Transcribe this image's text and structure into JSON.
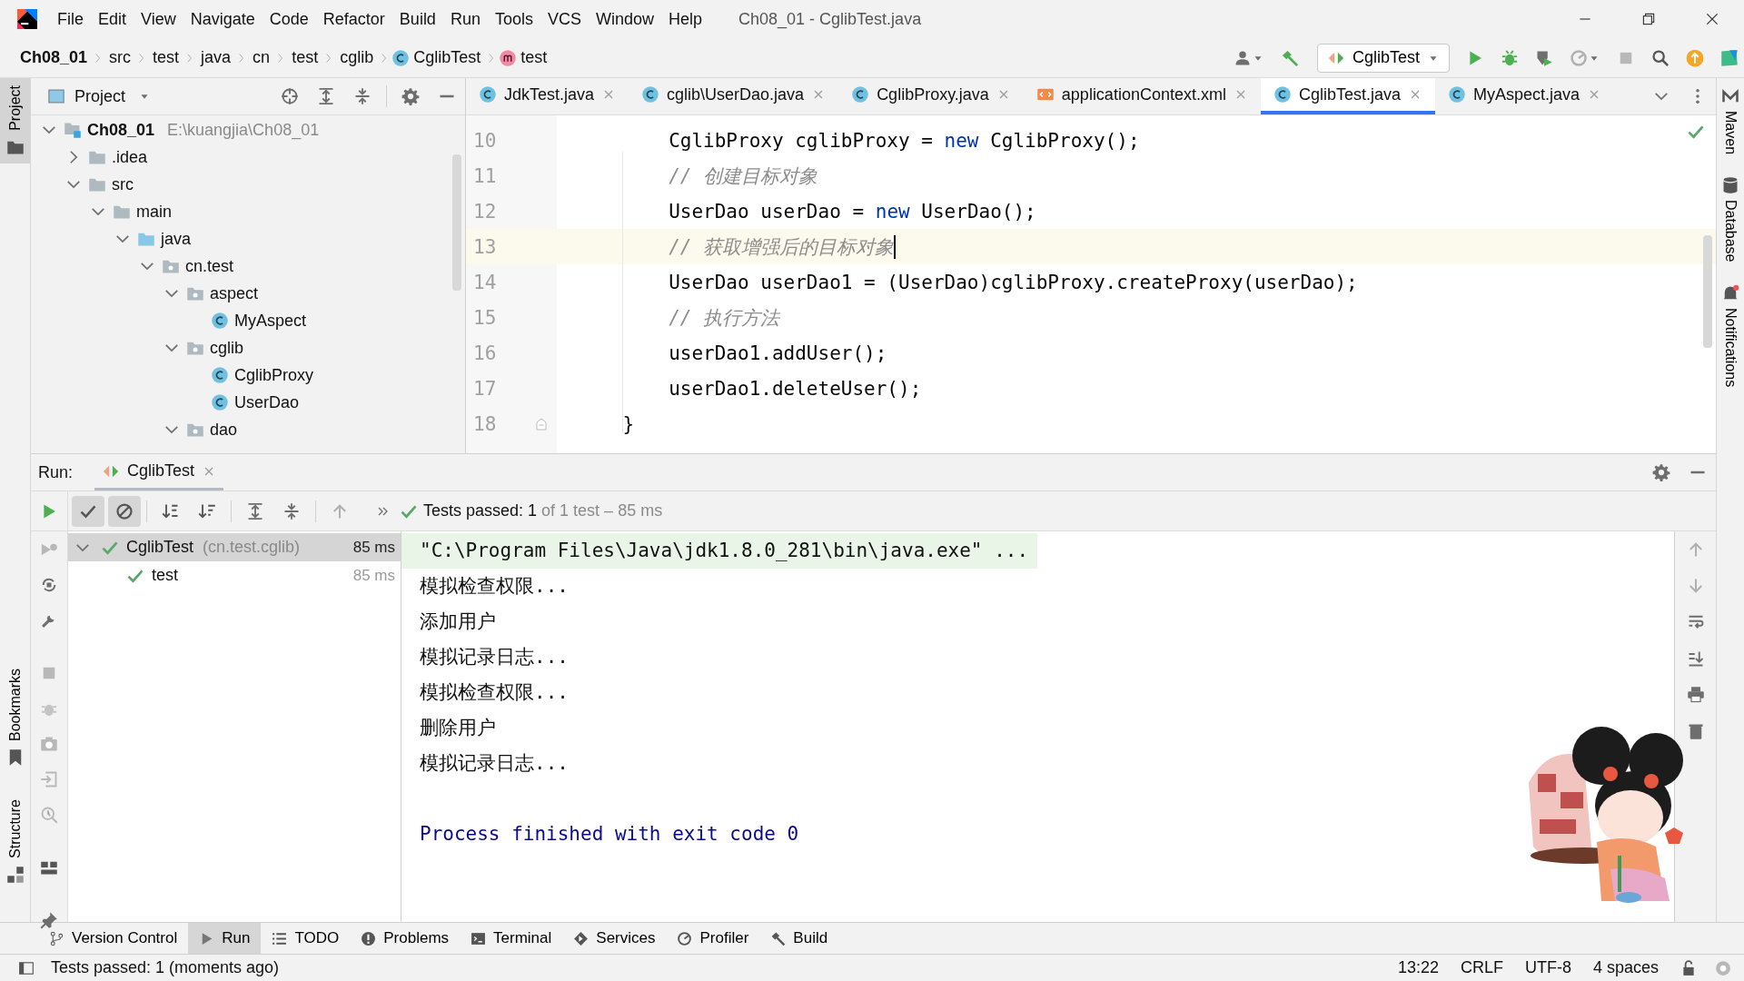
{
  "menu_bar": {
    "menus": [
      "File",
      "Edit",
      "View",
      "Navigate",
      "Code",
      "Refactor",
      "Build",
      "Run",
      "Tools",
      "VCS",
      "Window",
      "Help"
    ],
    "title": "Ch08_01 - CglibTest.java"
  },
  "breadcrumbs": [
    {
      "label": "Ch08_01",
      "kind": "project"
    },
    {
      "label": "src",
      "kind": "folder"
    },
    {
      "label": "test",
      "kind": "folder"
    },
    {
      "label": "java",
      "kind": "folder"
    },
    {
      "label": "cn",
      "kind": "folder"
    },
    {
      "label": "test",
      "kind": "folder"
    },
    {
      "label": "cglib",
      "kind": "folder"
    },
    {
      "label": "CglibTest",
      "kind": "class"
    },
    {
      "label": "test",
      "kind": "method"
    }
  ],
  "run_config": {
    "label": "CglibTest"
  },
  "left_stripe": [
    {
      "label": "Project",
      "kind": "project",
      "selected": true
    },
    {
      "label": "Bookmarks",
      "kind": "bookmarks",
      "selected": false
    },
    {
      "label": "Structure",
      "kind": "structure",
      "selected": false
    }
  ],
  "right_stripe": [
    {
      "label": "Maven",
      "kind": "maven"
    },
    {
      "label": "Database",
      "kind": "database"
    },
    {
      "label": "Notifications",
      "kind": "notifications"
    }
  ],
  "project_panel": {
    "title": "Project",
    "tree": [
      {
        "label": "Ch08_01",
        "kind": "module",
        "path": "E:\\kuangjia\\Ch08_01",
        "expanded": true,
        "children": [
          {
            "label": ".idea",
            "kind": "folder",
            "expanded": false
          },
          {
            "label": "src",
            "kind": "folder",
            "expanded": true,
            "children": [
              {
                "label": "main",
                "kind": "folder",
                "expanded": true,
                "children": [
                  {
                    "label": "java",
                    "kind": "source_root",
                    "expanded": true,
                    "children": [
                      {
                        "label": "cn.test",
                        "kind": "package",
                        "expanded": true,
                        "children": [
                          {
                            "label": "aspect",
                            "kind": "package",
                            "expanded": true,
                            "children": [
                              {
                                "label": "MyAspect",
                                "kind": "class"
                              }
                            ]
                          },
                          {
                            "label": "cglib",
                            "kind": "package",
                            "expanded": true,
                            "children": [
                              {
                                "label": "CglibProxy",
                                "kind": "class"
                              },
                              {
                                "label": "UserDao",
                                "kind": "class"
                              }
                            ]
                          },
                          {
                            "label": "dao",
                            "kind": "package",
                            "expanded": true
                          }
                        ]
                      }
                    ]
                  }
                ]
              }
            ]
          }
        ]
      }
    ]
  },
  "editor_tabs": [
    {
      "label": "JdkTest.java",
      "kind": "class",
      "selected": false
    },
    {
      "label": "cglib\\UserDao.java",
      "kind": "class",
      "selected": false
    },
    {
      "label": "CglibProxy.java",
      "kind": "class",
      "selected": false
    },
    {
      "label": "applicationContext.xml",
      "kind": "xml",
      "selected": false
    },
    {
      "label": "CglibTest.java",
      "kind": "class",
      "selected": true
    },
    {
      "label": "MyAspect.java",
      "kind": "class",
      "selected": false
    }
  ],
  "code": [
    {
      "number": "10",
      "current": false,
      "tokens": [
        {
          "kind": "plain",
          "text": "        CglibProxy cglibProxy = "
        },
        {
          "kind": "keyword",
          "text": "new"
        },
        {
          "kind": "plain",
          "text": " CglibProxy();"
        }
      ]
    },
    {
      "number": "11",
      "current": false,
      "tokens": [
        {
          "kind": "comment",
          "text": "        // 创建目标对象"
        }
      ]
    },
    {
      "number": "12",
      "current": false,
      "tokens": [
        {
          "kind": "plain",
          "text": "        UserDao userDao = "
        },
        {
          "kind": "keyword",
          "text": "new"
        },
        {
          "kind": "plain",
          "text": " UserDao();"
        }
      ]
    },
    {
      "number": "13",
      "current": true,
      "tokens": [
        {
          "kind": "comment",
          "text": "        // 获取增强后的目标对象"
        }
      ]
    },
    {
      "number": "14",
      "current": false,
      "tokens": [
        {
          "kind": "plain",
          "text": "        UserDao userDao1 = (UserDao)cglibProxy.createProxy(userDao);"
        }
      ]
    },
    {
      "number": "15",
      "current": false,
      "tokens": [
        {
          "kind": "comment",
          "text": "        // 执行方法"
        }
      ]
    },
    {
      "number": "16",
      "current": false,
      "tokens": [
        {
          "kind": "plain",
          "text": "        userDao1.addUser();"
        }
      ]
    },
    {
      "number": "17",
      "current": false,
      "tokens": [
        {
          "kind": "plain",
          "text": "        userDao1.deleteUser();"
        }
      ]
    },
    {
      "number": "18",
      "current": false,
      "tokens": [
        {
          "kind": "plain",
          "text": "    }"
        }
      ]
    }
  ],
  "run_panel": {
    "label": "Run:",
    "tab": "CglibTest",
    "toggles": [
      {
        "kind": "passed",
        "selected": true
      },
      {
        "kind": "ignored",
        "selected": true
      }
    ],
    "summary": "Tests passed: 1",
    "summary_detail": "of 1 test – 85 ms",
    "tests": [
      {
        "name": "CglibTest",
        "package": "(cn.test.cglib)",
        "time": "85 ms",
        "passed": true,
        "selected": true,
        "expanded": true,
        "children": [
          {
            "name": "test",
            "time": "85 ms",
            "passed": true,
            "selected": false
          }
        ]
      }
    ],
    "console": [
      {
        "kind": "command",
        "text": "\"C:\\Program Files\\Java\\jdk1.8.0_281\\bin\\java.exe\" ..."
      },
      {
        "kind": "output",
        "text": "模拟检查权限..."
      },
      {
        "kind": "output",
        "text": "添加用户"
      },
      {
        "kind": "output",
        "text": "模拟记录日志..."
      },
      {
        "kind": "output",
        "text": "模拟检查权限..."
      },
      {
        "kind": "output",
        "text": "删除用户"
      },
      {
        "kind": "output",
        "text": "模拟记录日志..."
      },
      {
        "kind": "exit",
        "text": "Process finished with exit code 0"
      }
    ]
  },
  "tool_windows": [
    {
      "label": "Version Control",
      "kind": "vcs",
      "selected": false
    },
    {
      "label": "Run",
      "kind": "run",
      "selected": true
    },
    {
      "label": "TODO",
      "kind": "todo",
      "selected": false
    },
    {
      "label": "Problems",
      "kind": "problems",
      "selected": false
    },
    {
      "label": "Terminal",
      "kind": "terminal",
      "selected": false
    },
    {
      "label": "Services",
      "kind": "services",
      "selected": false
    },
    {
      "label": "Profiler",
      "kind": "profiler",
      "selected": false
    },
    {
      "label": "Build",
      "kind": "build",
      "selected": false
    }
  ],
  "status_bar": {
    "message": "Tests passed: 1 (moments ago)",
    "position": "13:22",
    "line_separator": "CRLF",
    "encoding": "UTF-8",
    "indent": "4 spaces"
  }
}
